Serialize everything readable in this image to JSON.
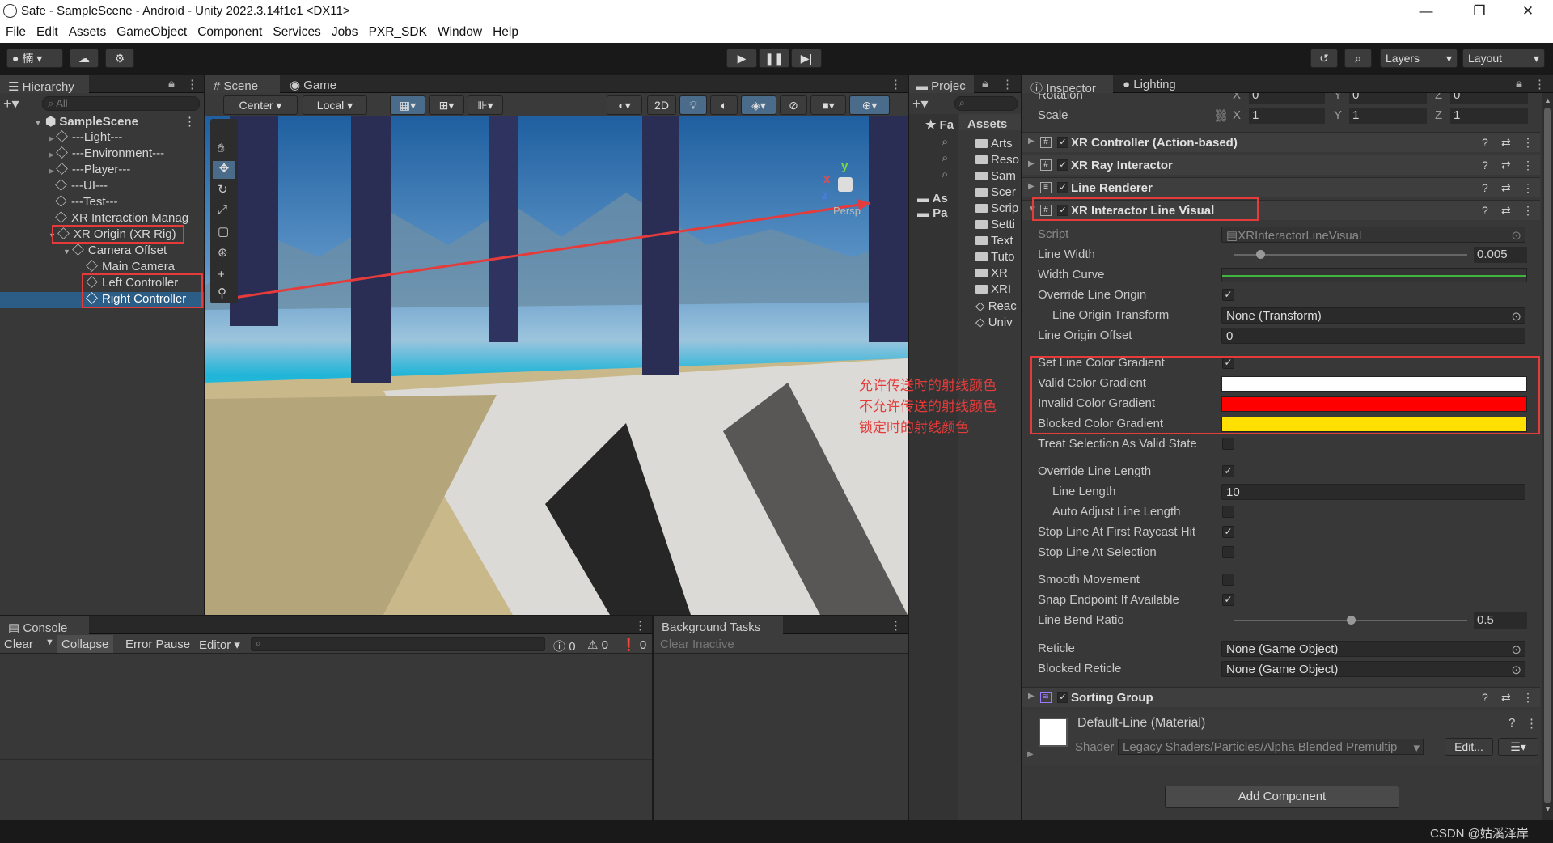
{
  "window": {
    "title": "Safe - SampleScene - Android - Unity 2022.3.14f1c1 <DX11>",
    "minimize": "—",
    "maximize": "❐",
    "close": "✕"
  },
  "menu": [
    "File",
    "Edit",
    "Assets",
    "GameObject",
    "Component",
    "Services",
    "Jobs",
    "PXR_SDK",
    "Window",
    "Help"
  ],
  "toolbar": {
    "account": "楠",
    "layers": "Layers",
    "layout": "Layout"
  },
  "hierarchy": {
    "tab": "Hierarchy",
    "search_placeholder": "All",
    "scene": "SampleScene",
    "items": [
      {
        "label": "---Light---"
      },
      {
        "label": "---Environment---"
      },
      {
        "label": "---Player---"
      },
      {
        "label": "---UI---"
      },
      {
        "label": "---Test---"
      },
      {
        "label": "XR Interaction Manag"
      },
      {
        "label": "XR Origin (XR Rig)"
      },
      {
        "label": "Camera Offset"
      },
      {
        "label": "Main Camera"
      },
      {
        "label": "Left Controller"
      },
      {
        "label": "Right Controller"
      }
    ]
  },
  "scene": {
    "tabs": [
      "Scene",
      "Game"
    ],
    "pivot": "Center",
    "space": "Local",
    "mode_2d": "2D",
    "gizmo_label": "Persp"
  },
  "project": {
    "tab": "Projec",
    "favorites": "Fa",
    "assets_label": "Assets",
    "assets_short": "As",
    "packages_short": "Pa",
    "items": [
      "Arts",
      "Reso",
      "Sam",
      "Scer",
      "Scrip",
      "Setti",
      "Text",
      "Tuto",
      "XR",
      "XRI",
      "Reac",
      "Univ"
    ]
  },
  "inspector": {
    "tabs": [
      "Inspector",
      "Lighting"
    ],
    "rotation_label": "Rotation",
    "rotation": [
      "0",
      "0",
      "0"
    ],
    "scale_label": "Scale",
    "scale": [
      "1",
      "1",
      "1"
    ],
    "axes": [
      "X",
      "Y",
      "Z"
    ],
    "components": [
      "XR Controller (Action-based)",
      "XR Ray Interactor",
      "Line Renderer",
      "XR Interactor Line Visual"
    ],
    "fields": {
      "script": {
        "label": "Script",
        "value": "XRInteractorLineVisual"
      },
      "line_width": {
        "label": "Line Width",
        "value": "0.005",
        "fraction": 0.11
      },
      "width_curve": {
        "label": "Width Curve"
      },
      "override_line_origin": {
        "label": "Override Line Origin",
        "checked": true
      },
      "line_origin_transform": {
        "label": "Line Origin Transform",
        "value": "None (Transform)"
      },
      "line_origin_offset": {
        "label": "Line Origin Offset",
        "value": "0"
      },
      "set_line_color_gradient": {
        "label": "Set Line Color Gradient",
        "checked": true
      },
      "valid_color_gradient": {
        "label": "Valid Color Gradient",
        "color": "#ffffff"
      },
      "invalid_color_gradient": {
        "label": "Invalid Color Gradient",
        "color": "#ff0000"
      },
      "blocked_color_gradient": {
        "label": "Blocked Color Gradient",
        "color": "#ffe000"
      },
      "treat_selection": {
        "label": "Treat Selection As Valid State",
        "checked": false
      },
      "override_line_length": {
        "label": "Override Line Length",
        "checked": true
      },
      "line_length": {
        "label": "Line Length",
        "value": "10"
      },
      "auto_adjust": {
        "label": "Auto Adjust Line Length",
        "checked": false
      },
      "stop_first_hit": {
        "label": "Stop Line At First Raycast Hit",
        "checked": true
      },
      "stop_selection": {
        "label": "Stop Line At Selection",
        "checked": false
      },
      "smooth_movement": {
        "label": "Smooth Movement",
        "checked": false
      },
      "snap_endpoint": {
        "label": "Snap Endpoint If Available",
        "checked": true
      },
      "line_bend_ratio": {
        "label": "Line Bend Ratio",
        "value": "0.5",
        "fraction": 0.5
      },
      "reticle": {
        "label": "Reticle",
        "value": "None (Game Object)"
      },
      "blocked_reticle": {
        "label": "Blocked Reticle",
        "value": "None (Game Object)"
      }
    },
    "sorting_group": "Sorting Group",
    "material": {
      "name": "Default-Line (Material)",
      "shader_label": "Shader",
      "shader": "Legacy Shaders/Particles/Alpha Blended Premultip",
      "edit": "Edit..."
    },
    "add_component": "Add Component"
  },
  "console": {
    "tab": "Console",
    "clear": "Clear",
    "collapse": "Collapse",
    "error_pause": "Error Pause",
    "editor": "Editor",
    "counts": [
      "0",
      "0",
      "0"
    ]
  },
  "background_tasks": {
    "tab": "Background Tasks",
    "clear_inactive": "Clear Inactive"
  },
  "annotations": [
    "允许传送时的射线颜色",
    "不允许传送的射线颜色",
    "锁定时的射线颜色"
  ],
  "watermark": "CSDN @姑溪泽岸",
  "colors": {
    "accent_red": "#e53b3b",
    "selection": "#2c5d87",
    "line_green": "#3fb53f"
  }
}
